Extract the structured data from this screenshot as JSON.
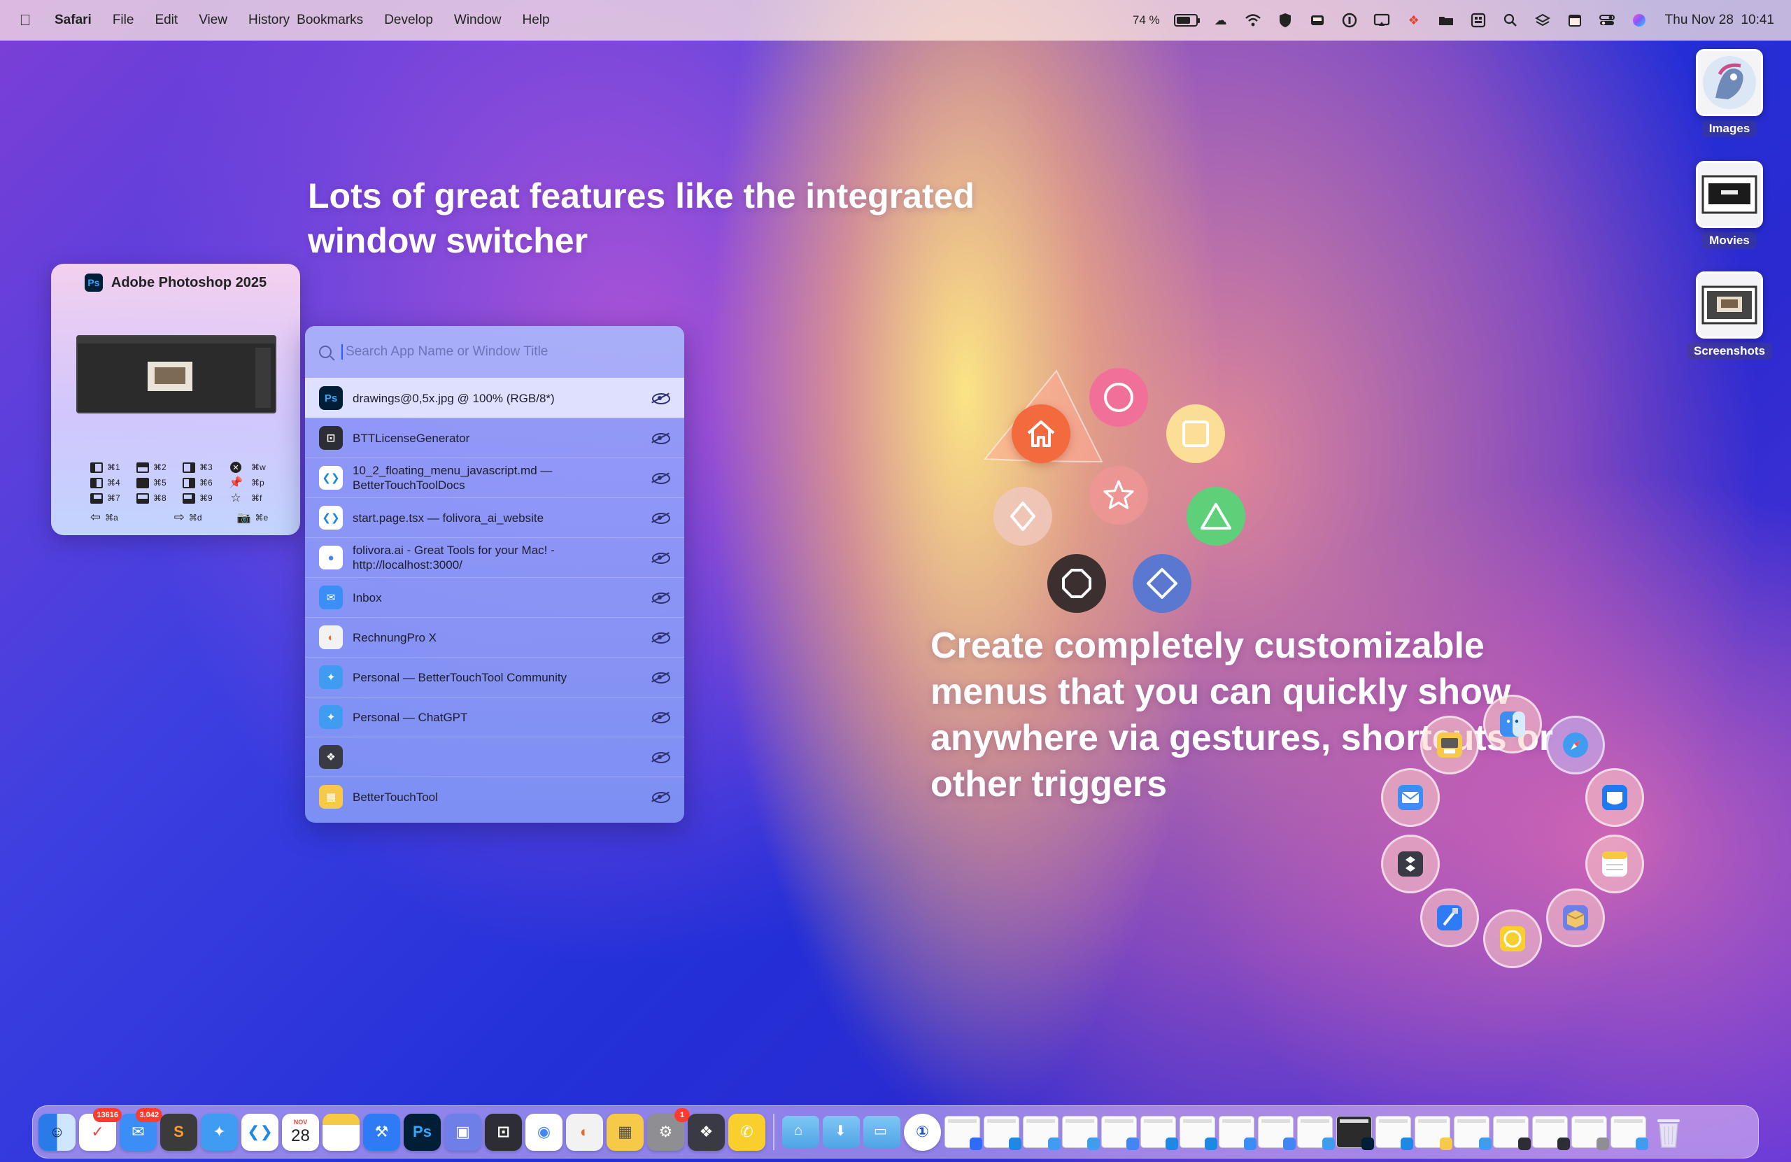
{
  "menubar": {
    "app_name": "Safari",
    "menus": [
      "File",
      "Edit",
      "View",
      "History",
      "Bookmarks",
      "Develop",
      "Window",
      "Help"
    ],
    "battery_percent": "74 %",
    "battery_level": 0.74,
    "datetime": "Thu Nov 28  10:41"
  },
  "headlines": {
    "switcher": "Lots of great features like the integrated window switcher",
    "menus": "Create completely customizable menus that you can quickly show anywhere via gestures, shortcuts or other triggers"
  },
  "desktop": [
    {
      "label": "Images"
    },
    {
      "label": "Movies"
    },
    {
      "label": "Screenshots"
    }
  ],
  "ps_card": {
    "title": "Adobe Photoshop 2025",
    "badge": "Ps",
    "shortcuts": [
      "⌘1",
      "⌘2",
      "⌘3",
      "⌘w",
      "⌘4",
      "⌘5",
      "⌘6",
      "⌘p",
      "⌘7",
      "⌘8",
      "⌘9",
      "⌘f",
      "⌘a",
      "⌘d",
      "⌘e"
    ]
  },
  "switcher": {
    "placeholder": "Search App Name or Window Title",
    "windows": [
      {
        "title": "drawings@0,5x.jpg @ 100% (RGB/8*)",
        "icon": "photoshop-icon",
        "glyph": "Ps",
        "color": "#001e36",
        "fg": "#31a8ff"
      },
      {
        "title": "BTTLicenseGenerator",
        "icon": "license-generator-icon",
        "glyph": "⊡",
        "color": "#2d2d35",
        "fg": "#ffffff"
      },
      {
        "title": "10_2_floating_menu_javascript.md — BetterTouchToolDocs",
        "icon": "vscode-icon",
        "glyph": "❮❯",
        "color": "#ffffff",
        "fg": "#1e88e5"
      },
      {
        "title": "start.page.tsx — folivora_ai_website",
        "icon": "vscode-icon",
        "glyph": "❮❯",
        "color": "#ffffff",
        "fg": "#1e88e5"
      },
      {
        "title": "folivora.ai - Great Tools for your Mac! - http://localhost:3000/",
        "icon": "chrome-icon",
        "glyph": "●",
        "color": "#ffffff",
        "fg": "#4285f4"
      },
      {
        "title": "Inbox",
        "icon": "mail-icon",
        "glyph": "✉",
        "color": "#3a8ef6",
        "fg": "#ffffff"
      },
      {
        "title": "RechnungPro X",
        "icon": "rechnungpro-icon",
        "glyph": "◐",
        "color": "#f2f2f2",
        "fg": "#e46b2e"
      },
      {
        "title": "Personal — BetterTouchTool Community",
        "icon": "safari-icon",
        "glyph": "✦",
        "color": "#3f9cf0",
        "fg": "#ffffff"
      },
      {
        "title": "Personal — ChatGPT",
        "icon": "safari-icon",
        "glyph": "✦",
        "color": "#3f9cf0",
        "fg": "#ffffff"
      },
      {
        "title": "",
        "icon": "dropbox-icon",
        "glyph": "❖",
        "color": "#3a3a44",
        "fg": "#ffffff"
      },
      {
        "title": "BetterTouchTool",
        "icon": "bettertouchtool-icon",
        "glyph": "▦",
        "color": "#f7c948",
        "fg": "#ffffff"
      }
    ]
  },
  "dock": {
    "mail_badge": "3.042",
    "reminders_badge": "13616",
    "settings_badge": "1",
    "calendar_month": "NOV",
    "calendar_day": "28"
  },
  "colors": {
    "accent": "#2a5bff",
    "menubar_bg": "#ffece2"
  }
}
